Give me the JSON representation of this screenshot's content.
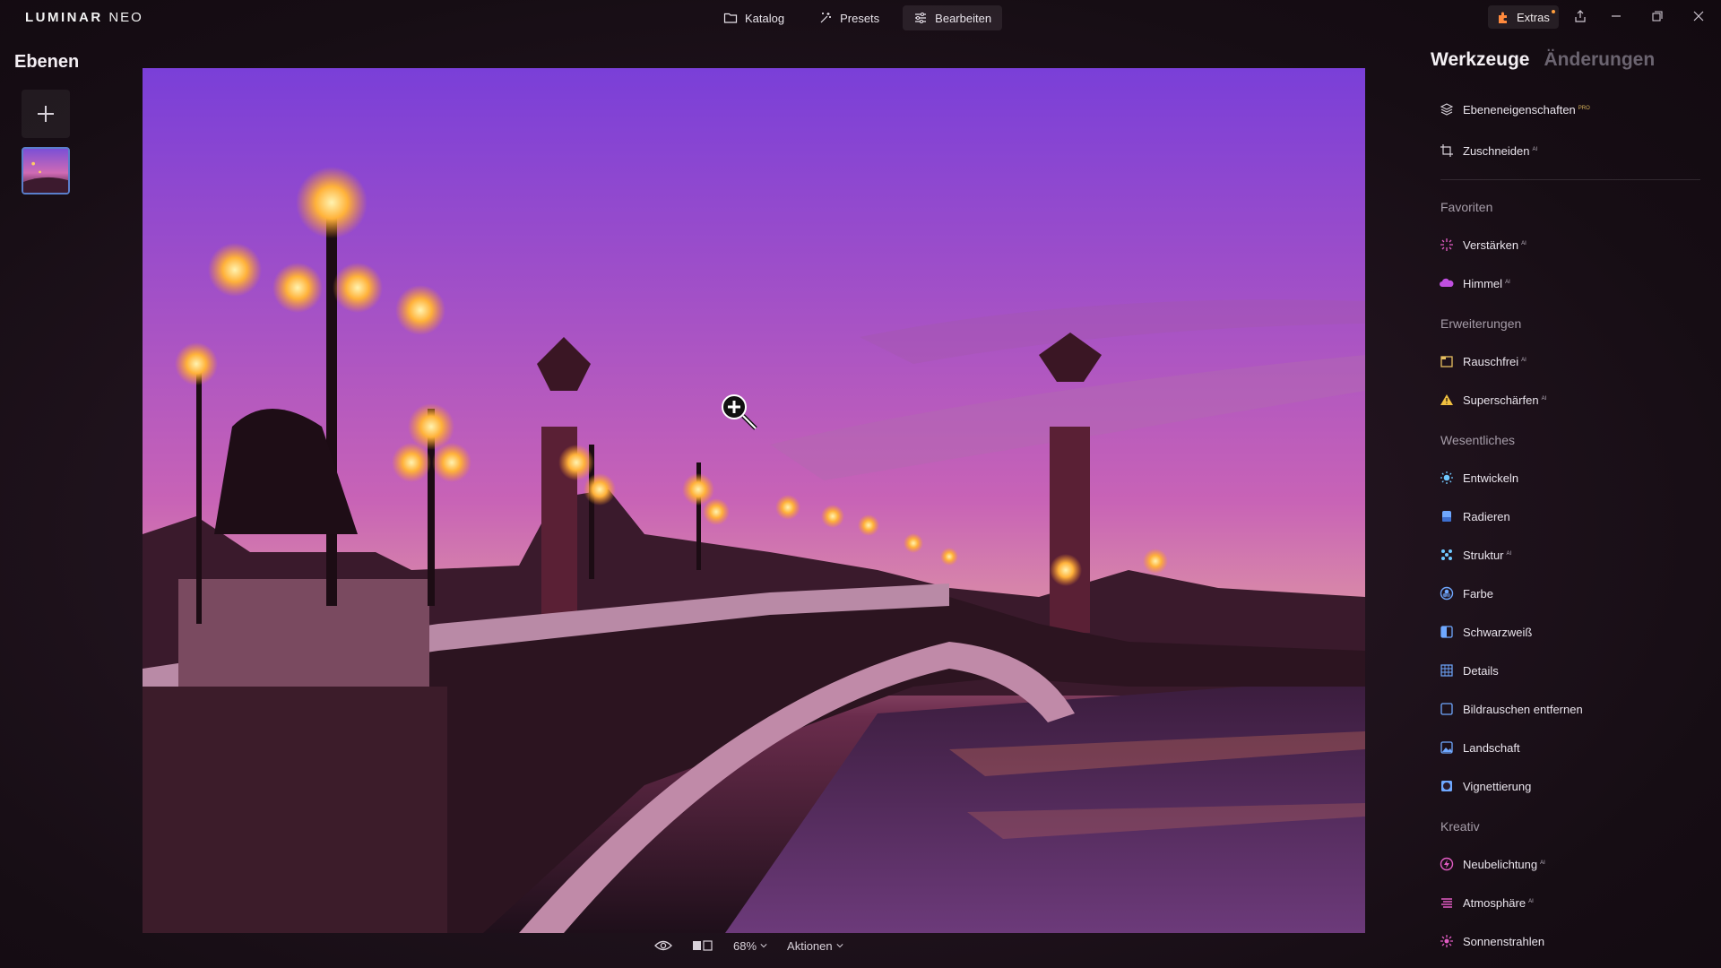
{
  "app": {
    "brand_main": "LUMINAR",
    "brand_sub": "NEO"
  },
  "nav": {
    "katalog": "Katalog",
    "presets": "Presets",
    "bearbeiten": "Bearbeiten"
  },
  "extras": {
    "label": "Extras"
  },
  "left_panel": {
    "title": "Ebenen"
  },
  "bottom": {
    "zoom": "68%",
    "actions": "Aktionen"
  },
  "right_panel": {
    "tabs": {
      "tools": "Werkzeuge",
      "changes": "Änderungen"
    },
    "top_tools": [
      {
        "label": "Ebeneneigenschaften",
        "badge": "PRO"
      },
      {
        "label": "Zuschneiden",
        "badge": "AI"
      }
    ],
    "sections": {
      "favoriten": "Favoriten",
      "erweiterungen": "Erweiterungen",
      "wesentliches": "Wesentliches",
      "kreativ": "Kreativ"
    },
    "favoriten": [
      {
        "label": "Verstärken",
        "badge": "AI"
      },
      {
        "label": "Himmel",
        "badge": "AI"
      }
    ],
    "erweiterungen": [
      {
        "label": "Rauschfrei",
        "badge": "AI"
      },
      {
        "label": "Superschärfen",
        "badge": "AI"
      }
    ],
    "wesentliches": [
      {
        "label": "Entwickeln"
      },
      {
        "label": "Radieren"
      },
      {
        "label": "Struktur",
        "badge": "AI"
      },
      {
        "label": "Farbe"
      },
      {
        "label": "Schwarzweiß"
      },
      {
        "label": "Details"
      },
      {
        "label": "Bildrauschen entfernen"
      },
      {
        "label": "Landschaft"
      },
      {
        "label": "Vignettierung"
      }
    ],
    "kreativ": [
      {
        "label": "Neubelichtung",
        "badge": "AI"
      },
      {
        "label": "Atmosphäre",
        "badge": "AI"
      },
      {
        "label": "Sonnenstrahlen"
      }
    ]
  },
  "colors": {
    "accent_blue": "#5a7ecb",
    "tool_icon_blue": "#6fa8ff",
    "tool_icon_pink": "#e25cc4",
    "pro_gold": "#d8b35a"
  }
}
